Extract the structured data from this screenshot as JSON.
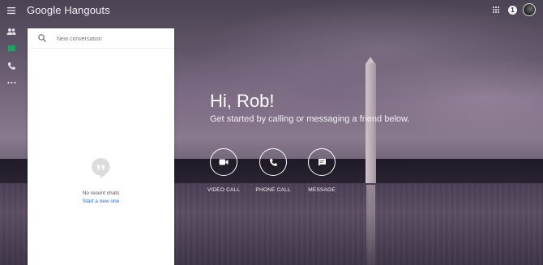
{
  "header": {
    "brand": "Google Hangouts",
    "notification_count": "1"
  },
  "sidebar": {
    "items": [
      {
        "name": "menu-icon"
      },
      {
        "name": "contacts-icon"
      },
      {
        "name": "chat-icon"
      },
      {
        "name": "phone-icon"
      },
      {
        "name": "more-icon"
      }
    ]
  },
  "conversations": {
    "search_placeholder": "New conversation",
    "empty_text": "No recent chats",
    "start_link": "Start a new one"
  },
  "main": {
    "greeting": "Hi, Rob!",
    "subtitle": "Get started by calling or messaging a friend below.",
    "actions": [
      {
        "label": "VIDEO CALL",
        "icon": "video-icon"
      },
      {
        "label": "PHONE CALL",
        "icon": "phone-icon"
      },
      {
        "label": "MESSAGE",
        "icon": "message-icon"
      }
    ]
  },
  "colors": {
    "accent_green": "#1ea362",
    "link_blue": "#2b6cdb"
  }
}
